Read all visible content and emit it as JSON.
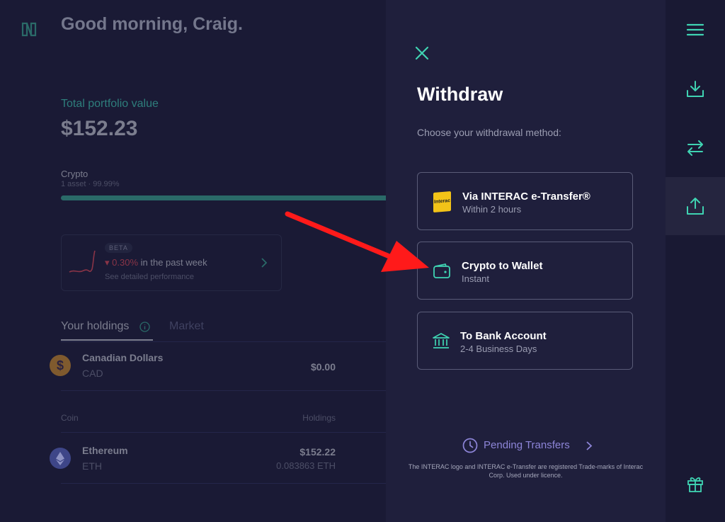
{
  "dashboard": {
    "greeting": "Good morning, Craig.",
    "portfolio_label": "Total portfolio value",
    "portfolio_value": "$152.23",
    "crypto_label": "Crypto",
    "crypto_sub": "1 asset · 99.99%",
    "crypto_share_pct": 99.99,
    "beta_badge": "BETA",
    "perf_change": "0.30%",
    "perf_suffix": "in the past week",
    "perf_link": "See detailed performance",
    "tabs": [
      "Your holdings",
      "Market"
    ],
    "cash": {
      "name": "Canadian Dollars",
      "code": "CAD",
      "value": "$0.00",
      "icon": "dollar-icon"
    },
    "columns": {
      "coin": "Coin",
      "holdings": "Holdings"
    },
    "coins": [
      {
        "name": "Ethereum",
        "code": "ETH",
        "value": "$152.22",
        "amount": "0.083863 ETH",
        "icon": "ethereum-icon"
      }
    ]
  },
  "withdraw": {
    "title": "Withdraw",
    "subtitle": "Choose your withdrawal method:",
    "methods": [
      {
        "title": "Via INTERAC e-Transfer®",
        "sub": "Within 2 hours",
        "icon": "interac-logo",
        "logo_text": "Interac"
      },
      {
        "title": "Crypto to Wallet",
        "sub": "Instant",
        "icon": "wallet-icon"
      },
      {
        "title": "To Bank Account",
        "sub": "2-4 Business Days",
        "icon": "bank-icon"
      }
    ],
    "pending": "Pending Transfers",
    "disclaimer": "The INTERAC logo and INTERAC e-Transfer are registered Trade-marks of Interac Corp. Used under licence."
  },
  "rail": {
    "items": [
      "menu-icon",
      "deposit-icon",
      "transfer-icon",
      "withdraw-icon",
      "gift-icon"
    ],
    "active": "withdraw-icon"
  },
  "colors": {
    "accent": "#3fd3b2",
    "panel": "#1f1f3c",
    "background": "#191933",
    "negative": "#d9475f",
    "annotation_arrow": "#ff1a1a",
    "pending_link": "#8d85d8"
  }
}
